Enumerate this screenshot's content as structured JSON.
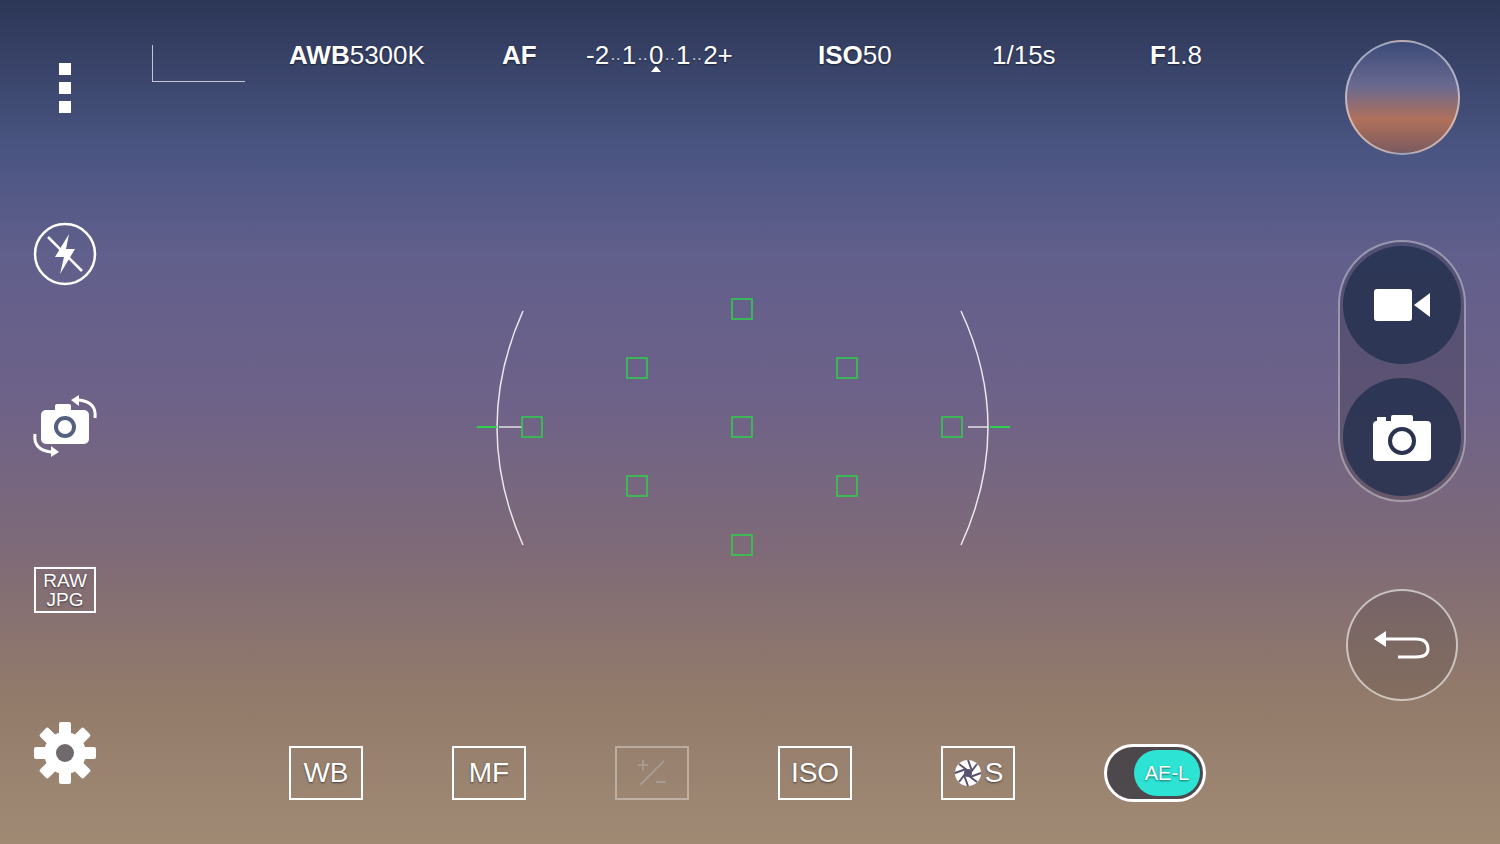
{
  "top_bar": {
    "white_balance": {
      "label": "AWB",
      "value": "5300K"
    },
    "focus_mode": "AF",
    "exposure": {
      "ticks": [
        {
          "label": "-2",
          "selected": false
        },
        {
          "label": "1",
          "selected": false
        },
        {
          "label": "0",
          "selected": true
        },
        {
          "label": "1",
          "selected": false
        },
        {
          "label": "2+",
          "selected": false
        }
      ],
      "separator": "··"
    },
    "iso": {
      "label": "ISO",
      "value": "50"
    },
    "shutter_speed": "1/15s",
    "aperture": {
      "label": "F",
      "value": "1.8"
    }
  },
  "left_bar": {
    "flash": {
      "on": false
    },
    "format": {
      "raw": "RAW",
      "jpg": "JPG"
    }
  },
  "bottom_bar": {
    "controls": [
      {
        "kind": "text",
        "label": "WB",
        "disabled": false
      },
      {
        "kind": "text",
        "label": "MF",
        "disabled": false
      },
      {
        "kind": "ev",
        "disabled": true
      },
      {
        "kind": "text",
        "label": "ISO",
        "disabled": false
      },
      {
        "kind": "shutter",
        "label": "S",
        "disabled": false
      }
    ],
    "ae_lock": {
      "label": "AE-L",
      "on": true
    }
  },
  "right_bar": {
    "modes": [
      {
        "kind": "video"
      },
      {
        "kind": "photo"
      }
    ]
  }
}
